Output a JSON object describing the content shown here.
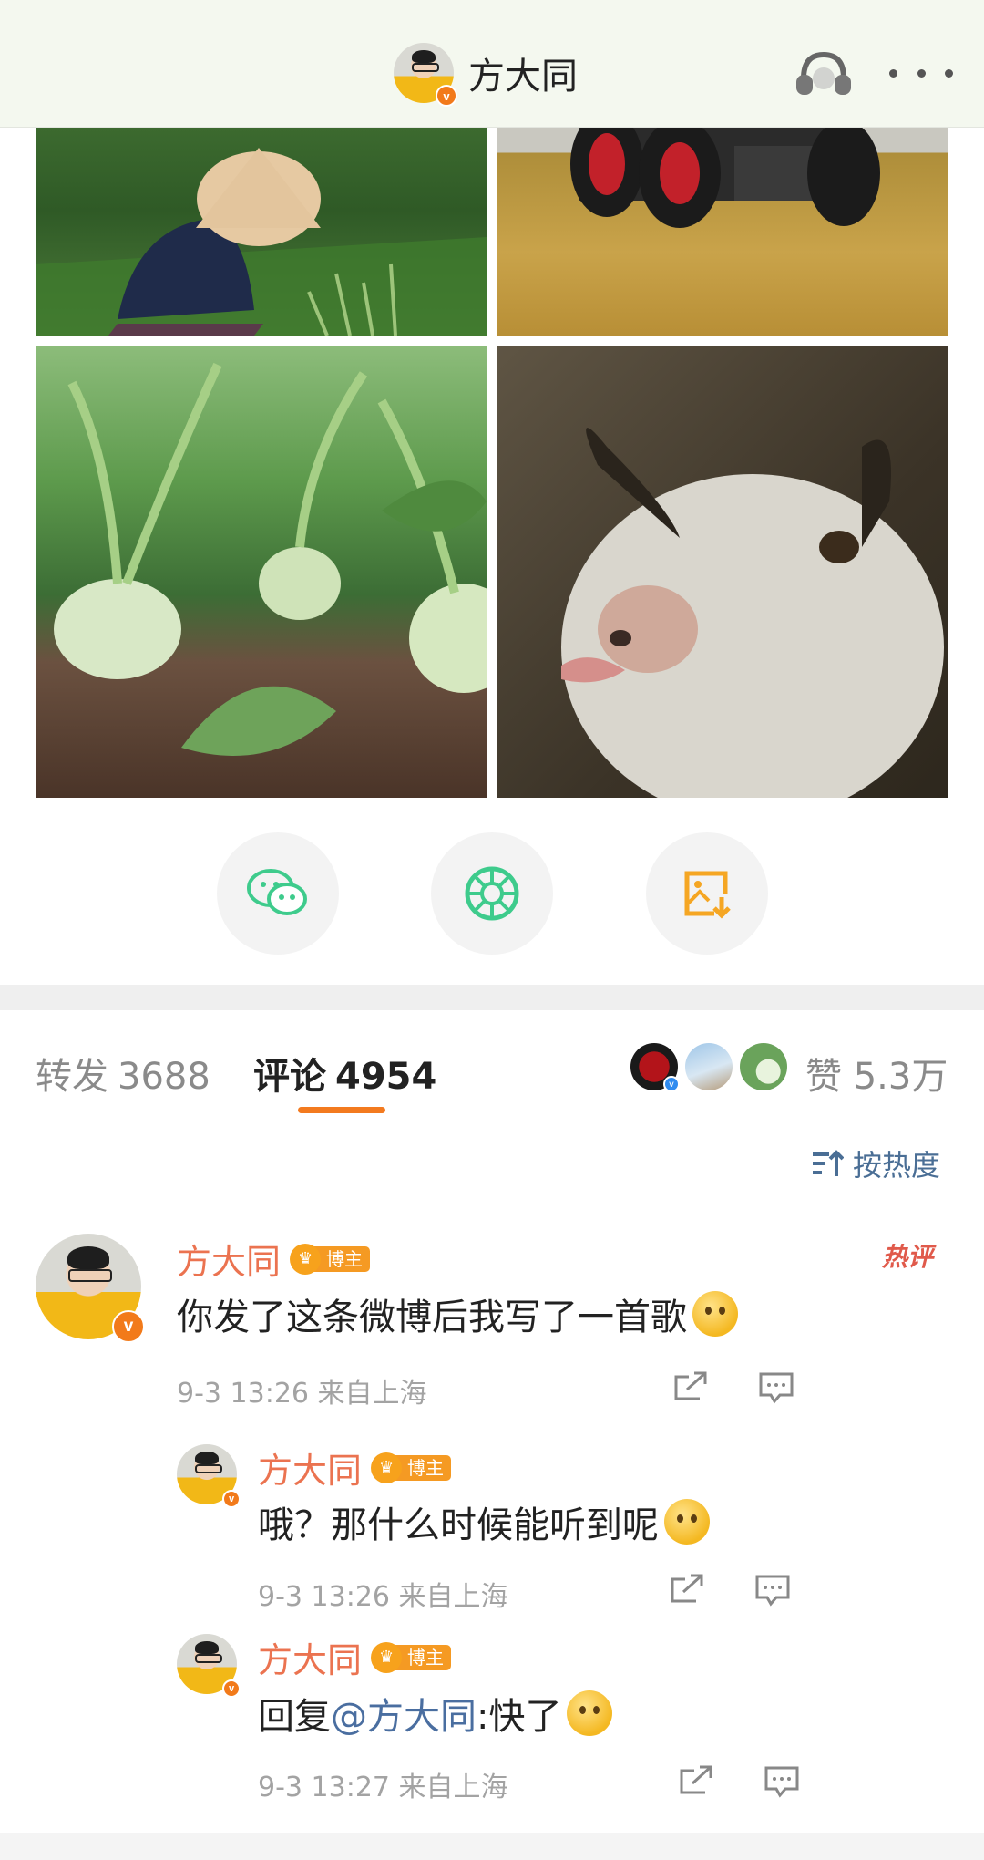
{
  "header": {
    "name": "方大同"
  },
  "tabs": {
    "repost_label": "转发",
    "repost_count": "3688",
    "comment_label": "评论",
    "comment_count": "4954",
    "like_label": "赞",
    "like_count": "5.3万"
  },
  "sort": {
    "label": "按热度"
  },
  "comments": [
    {
      "name": "方大同",
      "badge": "博主",
      "text": "你发了这条微博后我写了一首歌",
      "time": "9-3 13:26",
      "location": "来自上海",
      "hot": "热评"
    }
  ],
  "replies": [
    {
      "name": "方大同",
      "badge": "博主",
      "text": "哦？那什么时候能听到呢",
      "time": "9-3 13:26",
      "location": "来自上海"
    },
    {
      "name": "方大同",
      "badge": "博主",
      "prefix": "回复",
      "mention": "@方大同",
      "text": ":快了",
      "time": "9-3 13:27",
      "location": "来自上海"
    }
  ],
  "icons": {
    "wechat": "wechat-icon",
    "moments": "moments-icon",
    "save_image": "save-image-icon",
    "headset": "headset-icon",
    "more": "more-icon"
  },
  "colors": {
    "accent": "#f37a1f",
    "username": "#eb7350",
    "wechat_green": "#3ecb8c",
    "save_orange": "#f5a623",
    "link_blue": "#4a6ea0"
  }
}
